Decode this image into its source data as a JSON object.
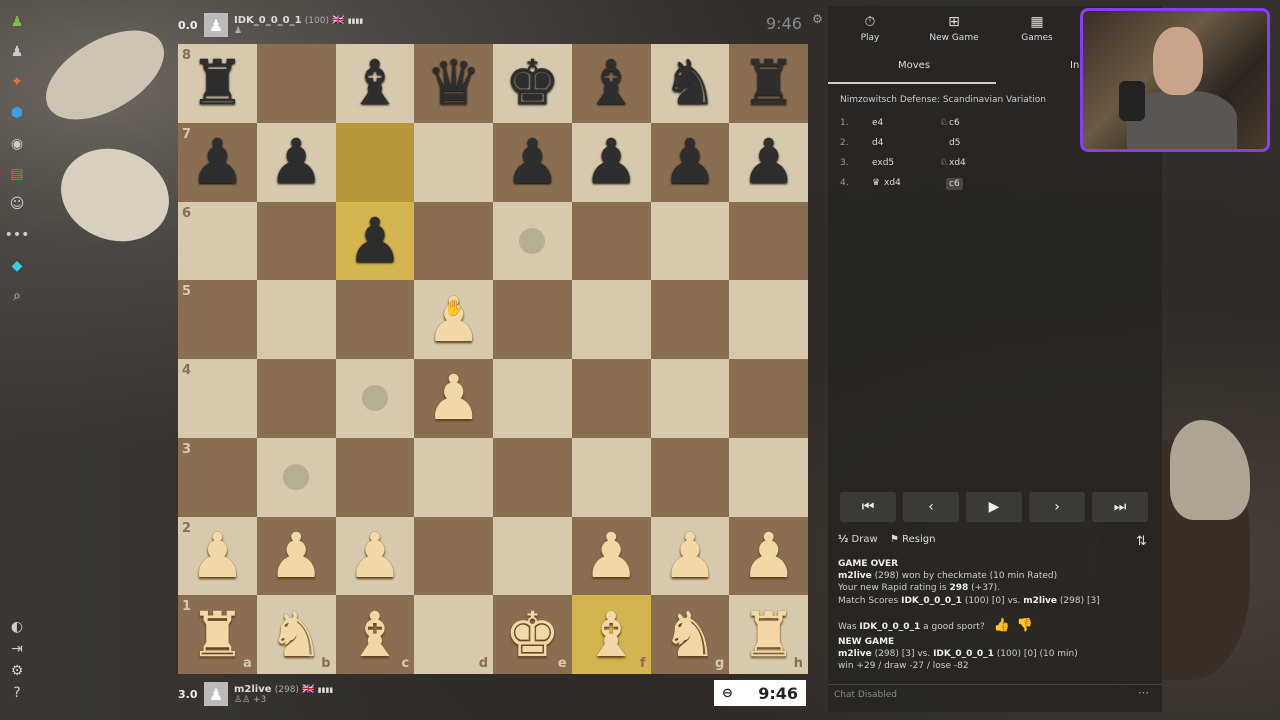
{
  "top_player": {
    "score": "0.0",
    "name": "IDK_0_0_0_1",
    "rating": "(100)",
    "flag": "🇬🇧",
    "bars": "▮▮▮▮",
    "timer": "9:46"
  },
  "bottom_player": {
    "score": "3.0",
    "name": "m2live",
    "rating": "(298)",
    "flag": "🇬🇧",
    "bars": "▮▮▮▮",
    "sub": "+3",
    "timer": "9:46"
  },
  "board": {
    "ranks": [
      "8",
      "7",
      "6",
      "5",
      "4",
      "3",
      "2",
      "1"
    ],
    "files": [
      "a",
      "b",
      "c",
      "d",
      "e",
      "f",
      "g",
      "h"
    ]
  },
  "panel": {
    "tabs": [
      {
        "label": "Play",
        "icon": "stopwatch-icon"
      },
      {
        "label": "New Game",
        "icon": "plus-icon"
      },
      {
        "label": "Games",
        "icon": "checker-icon"
      }
    ],
    "subtabs": [
      "Moves",
      "In"
    ],
    "opening": "Nimzowitsch Defense: Scandinavian Variation",
    "moves": [
      {
        "num": "1.",
        "white": "e4",
        "black": "c6",
        "black_icon": "♘"
      },
      {
        "num": "2.",
        "white": "d4",
        "black": "d5",
        "black_icon": ""
      },
      {
        "num": "3.",
        "white": "exd5",
        "black": "xd4",
        "black_icon": "♘"
      },
      {
        "num": "4.",
        "white": "xd4",
        "white_icon": "♛",
        "black": "c6",
        "black_icon": ""
      }
    ],
    "nav": [
      "⏮",
      "‹",
      "▶",
      "›",
      "⏭"
    ],
    "draw_label": "Draw",
    "resign_label": "Resign",
    "game_over": {
      "title": "GAME OVER",
      "winner": "m2live",
      "winner_rating": "(298)",
      "win_text": "won by checkmate (10 min Rated)",
      "rating_prefix": "Your new Rapid rating is",
      "new_rating": "298",
      "rating_delta": "(+37).",
      "match_prefix": "Match Scores",
      "match_p1": "IDK_0_0_0_1",
      "match_p1_info": "(100) [0] vs.",
      "match_p2": "m2live",
      "match_p2_info": "(298) [3]",
      "sport_prefix": "Was",
      "sport_name": "IDK_0_0_0_1",
      "sport_suffix": "a good sport?"
    },
    "new_game": {
      "title": "NEW GAME",
      "p1": "m2live",
      "p1_info": "(298) [3] vs.",
      "p2": "IDK_0_0_0_1",
      "p2_info": "(100) [0] (10 min)",
      "odds": "win +29 / draw -27 / lose -82"
    },
    "chat": "Chat Disabled"
  },
  "colors": {
    "light_square": "#d6c9ad",
    "dark_square": "#8a6e52",
    "highlight": "#d4b44e",
    "webcam_border": "#8a3cf0"
  }
}
